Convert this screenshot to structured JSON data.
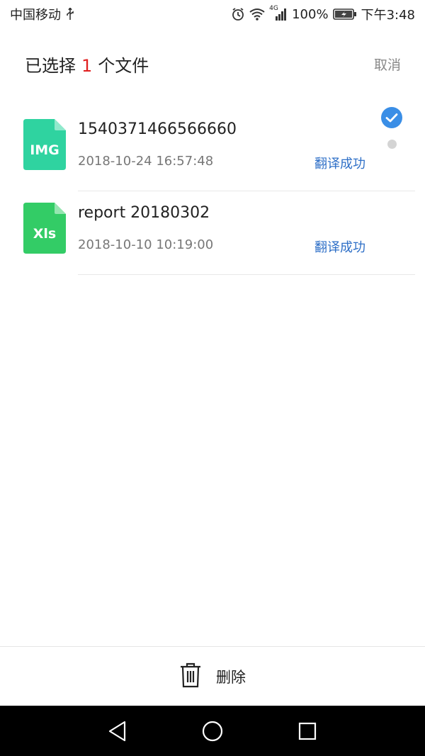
{
  "status_bar": {
    "carrier": "中国移动",
    "network": "4G",
    "battery": "100%",
    "time": "下午3:48"
  },
  "header": {
    "title_prefix": "已选择",
    "selected_count": "1",
    "title_suffix": "个文件",
    "cancel_label": "取消"
  },
  "files": [
    {
      "icon_label": "IMG",
      "name": "1540371466566660",
      "date": "2018-10-24 16:57:48",
      "status": "翻译成功",
      "selected": false
    },
    {
      "icon_label": "Xls",
      "name": "report  20180302",
      "date": "2018-10-10 10:19:00",
      "status": "翻译成功",
      "selected": true
    }
  ],
  "actions": {
    "delete_label": "删除"
  },
  "colors": {
    "accent_blue": "#2e6fc7",
    "check_blue": "#3a8ee6",
    "count_red": "#e02020",
    "img_icon_green": "#2fd3a0",
    "xls_icon_green": "#33cc66"
  }
}
